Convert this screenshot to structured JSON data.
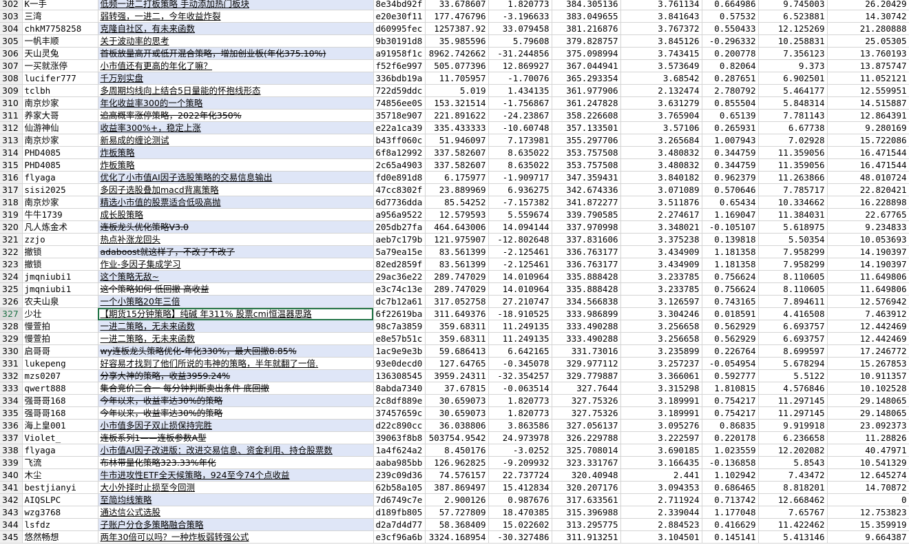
{
  "sheet": {
    "selected_row": "327",
    "rows": [
      {
        "n": "302",
        "user": "K一手",
        "strategy": "低频一进二打板策略 手动添加热门板块",
        "code": "8e34bd92f",
        "v1": "33.678607",
        "v2": "1.820773",
        "v3": "384.305136",
        "v4": "3.761134",
        "v5": "0.664986",
        "v6": "9.745003",
        "v7": "26.20429"
      },
      {
        "n": "303",
        "user": "三湾",
        "strategy": "弱转强，一进二，今年收益炸裂",
        "code": "e20e30f11",
        "v1": "177.476796",
        "v2": "-3.196633",
        "v3": "383.049655",
        "v4": "3.841643",
        "v5": "0.57532",
        "v6": "6.523881",
        "v7": "14.30742"
      },
      {
        "n": "304",
        "user": "chkM7758258",
        "strategy": "克隆自社区，有未来函数",
        "code": "d60995fec",
        "v1": "1257387.92",
        "v2": "33.079458",
        "v3": "381.216876",
        "v4": "3.767372",
        "v5": "0.550433",
        "v6": "12.125269",
        "v7": "21.280888"
      },
      {
        "n": "305",
        "user": "一帆丰顺",
        "strategy": "关于波动率的思考",
        "code": "9b30191d8",
        "v1": "35.985596",
        "v2": "5.79608",
        "v3": "379.828757",
        "v4": "3.845126",
        "v5": "-0.296332",
        "v6": "10.258831",
        "v7": "25.05305"
      },
      {
        "n": "306",
        "user": "天山灵兔",
        "strategy": "首板放量高开或低开混合策略，增加创业板(年化375.10%)",
        "code": "a91958f1c",
        "v1": "8962.742662",
        "v2": "-31.244856",
        "v3": "375.098994",
        "v4": "3.743415",
        "v5": "0.200778",
        "v6": "7.356123",
        "v7": "13.760193"
      },
      {
        "n": "307",
        "user": "一买就涨停",
        "strategy": "小市值还有更高的年化了嘛？",
        "code": "f52f6e997",
        "v1": "505.077396",
        "v2": "12.869927",
        "v3": "367.044941",
        "v4": "3.573649",
        "v5": "0.82064",
        "v6": "9.373",
        "v7": "13.875747"
      },
      {
        "n": "308",
        "user": "lucifer777",
        "strategy": "千万别实盘",
        "code": "336bdb19a",
        "v1": "11.705957",
        "v2": "-1.70076",
        "v3": "365.293354",
        "v4": "3.68542",
        "v5": "0.287651",
        "v6": "6.902501",
        "v7": "11.052121"
      },
      {
        "n": "309",
        "user": "tclbh",
        "strategy": "多周期均线向上结合5日量能的怀抱线形态",
        "code": "722d59ddc",
        "v1": "5.019",
        "v2": "1.434135",
        "v3": "361.977906",
        "v4": "2.132474",
        "v5": "2.780792",
        "v6": "5.464177",
        "v7": "12.559951"
      },
      {
        "n": "310",
        "user": "南京炒家",
        "strategy": "年化收益率300的一个策略",
        "code": "74856ee0S",
        "v1": "153.321514",
        "v2": "-1.756867",
        "v3": "361.247828",
        "v4": "3.631279",
        "v5": "0.855504",
        "v6": "5.848314",
        "v7": "14.515887"
      },
      {
        "n": "311",
        "user": "养家大哥",
        "strategy": "追高概率涨停策略，2022年化350%",
        "code": "35718e907",
        "v1": "221.891622",
        "v2": "-24.23867",
        "v3": "358.226608",
        "v4": "3.765904",
        "v5": "0.65139",
        "v6": "7.781143",
        "v7": "12.864391"
      },
      {
        "n": "312",
        "user": "仙游神仙",
        "strategy": "收益率300%+，稳定上涨",
        "code": "e22a1ca39",
        "v1": "335.433333",
        "v2": "-10.60748",
        "v3": "357.133501",
        "v4": "3.57106",
        "v5": "0.265931",
        "v6": "6.67738",
        "v7": "9.280169"
      },
      {
        "n": "313",
        "user": "南京炒家",
        "strategy": "新易成的缠论测试",
        "code": "b43ff060c",
        "v1": "51.946097",
        "v2": "7.173981",
        "v3": "355.297706",
        "v4": "3.265684",
        "v5": "1.007943",
        "v6": "7.02928",
        "v7": "15.722086"
      },
      {
        "n": "314",
        "user": "PHD4085",
        "strategy": "炸板策略",
        "code": "6f8a12992",
        "v1": "337.582607",
        "v2": "8.635022",
        "v3": "353.757508",
        "v4": "3.480832",
        "v5": "0.344759",
        "v6": "11.359056",
        "v7": "16.471544"
      },
      {
        "n": "315",
        "user": "PHD4085",
        "strategy": "炸板策略",
        "code": "2c65a4903",
        "v1": "337.582607",
        "v2": "8.635022",
        "v3": "353.757508",
        "v4": "3.480832",
        "v5": "0.344759",
        "v6": "11.359056",
        "v7": "16.471544"
      },
      {
        "n": "316",
        "user": "flyaga",
        "strategy": "优化了小市值AI因子选股策略的交易信息输出",
        "code": "fd0e891d8",
        "v1": "6.175977",
        "v2": "-1.909717",
        "v3": "347.359431",
        "v4": "3.840182",
        "v5": "0.962379",
        "v6": "11.263866",
        "v7": "48.010724"
      },
      {
        "n": "317",
        "user": "sisi2025",
        "strategy": "多因子选股叠加macd背离策略",
        "code": "47cc8302f",
        "v1": "23.889969",
        "v2": "6.936275",
        "v3": "342.674336",
        "v4": "3.071089",
        "v5": "0.570646",
        "v6": "7.785717",
        "v7": "22.820421"
      },
      {
        "n": "318",
        "user": "南京炒家",
        "strategy": "精选小市值的股票适合低吸高抛",
        "code": "6d7736dda",
        "v1": "85.54252",
        "v2": "-7.157382",
        "v3": "341.872277",
        "v4": "3.511876",
        "v5": "0.65434",
        "v6": "10.334662",
        "v7": "16.228898"
      },
      {
        "n": "319",
        "user": "牛牛1739",
        "strategy": "成长股策略",
        "code": "a956a9522",
        "v1": "12.579593",
        "v2": "5.559674",
        "v3": "339.790585",
        "v4": "2.274617",
        "v5": "1.169047",
        "v6": "11.384031",
        "v7": "22.67765"
      },
      {
        "n": "320",
        "user": "凡人炼金术",
        "strategy": "连板龙头优化策略V3.0",
        "code": "205db27fa",
        "v1": "464.643006",
        "v2": "14.094144",
        "v3": "337.970998",
        "v4": "3.348021",
        "v5": "-0.105107",
        "v6": "5.618975",
        "v7": "9.234833"
      },
      {
        "n": "321",
        "user": "zzjo",
        "strategy": "热点补涨龙回头",
        "code": "aeb7c179b",
        "v1": "121.975907",
        "v2": "-12.802648",
        "v3": "337.831606",
        "v4": "3.375238",
        "v5": "0.139818",
        "v6": "5.50354",
        "v7": "10.053693"
      },
      {
        "n": "322",
        "user": "撤锁",
        "strategy": "adaboost就这样了，不改了不改了",
        "code": "5a79ea15e",
        "v1": "83.561399",
        "v2": "-2.125461",
        "v3": "336.763177",
        "v4": "3.434909",
        "v5": "1.181358",
        "v6": "7.958299",
        "v7": "14.190397"
      },
      {
        "n": "323",
        "user": "撤锁",
        "strategy": "作业-多因子集成学习",
        "code": "82ed2859f",
        "v1": "83.561399",
        "v2": "-2.125461",
        "v3": "336.763177",
        "v4": "3.434909",
        "v5": "1.181358",
        "v6": "7.958299",
        "v7": "14.190397"
      },
      {
        "n": "324",
        "user": "jmqniubi1",
        "strategy": "这个策略无敌~",
        "code": "29ac36e22",
        "v1": "289.747029",
        "v2": "14.010964",
        "v3": "335.888428",
        "v4": "3.233785",
        "v5": "0.756624",
        "v6": "8.110605",
        "v7": "11.649806"
      },
      {
        "n": "325",
        "user": "jmqniubi1",
        "strategy": "这个策略如何 低回撤 高收益",
        "code": "e3c74c13e",
        "v1": "289.747029",
        "v2": "14.010964",
        "v3": "335.888428",
        "v4": "3.233785",
        "v5": "0.756624",
        "v6": "8.110605",
        "v7": "11.649806"
      },
      {
        "n": "326",
        "user": "农夫山泉",
        "strategy": "一个小策略20年三倍",
        "code": "dc7b12a61",
        "v1": "317.052758",
        "v2": "27.210747",
        "v3": "334.566838",
        "v4": "3.126597",
        "v5": "0.743165",
        "v6": "7.894611",
        "v7": "12.576942"
      },
      {
        "n": "327",
        "user": "少壮",
        "strategy": "【期货15分钟策略】纯碱 年311% 股票cmi恒温器思路",
        "code": "6f22619ba",
        "v1": "311.649376",
        "v2": "-18.910525",
        "v3": "333.986899",
        "v4": "3.304246",
        "v5": "0.018591",
        "v6": "4.416508",
        "v7": "7.463912"
      },
      {
        "n": "328",
        "user": "慢萱拍",
        "strategy": "一进二策略，无未来函数",
        "code": "98c7a3859",
        "v1": "359.68311",
        "v2": "11.249135",
        "v3": "333.490288",
        "v4": "3.256658",
        "v5": "0.562929",
        "v6": "6.693757",
        "v7": "12.442469"
      },
      {
        "n": "329",
        "user": "慢萱拍",
        "strategy": "一进二策略，无未来函数",
        "code": "e8e57b51c",
        "v1": "359.68311",
        "v2": "11.249135",
        "v3": "333.490288",
        "v4": "3.256658",
        "v5": "0.562929",
        "v6": "6.693757",
        "v7": "12.442469"
      },
      {
        "n": "330",
        "user": "启哥哥",
        "strategy": "wy连板龙头策略优化-年化330%，最大回撤8.85%",
        "code": "1ac9e9e3b",
        "v1": "59.686413",
        "v2": "6.642165",
        "v3": "331.73016",
        "v4": "3.235899",
        "v5": "0.226764",
        "v6": "8.699597",
        "v7": "17.246772"
      },
      {
        "n": "331",
        "user": "lukepeng",
        "strategy": "好容易才找到了他们所说的韦神的策略，半年就翻了一倍.",
        "code": "93e0decd0",
        "v1": "127.64765",
        "v2": "-0.345078",
        "v3": "329.977112",
        "v4": "3.257237",
        "v5": "-0.054954",
        "v6": "5.678294",
        "v7": "15.267853"
      },
      {
        "n": "332",
        "user": "mzs0207",
        "strategy": "分享大神的策略，收益3959.24%",
        "code": "136308545",
        "v1": "3959.24311",
        "v2": "-32.354257",
        "v3": "329.779887",
        "v4": "3.366061",
        "v5": "0.592777",
        "v6": "5.5122",
        "v7": "10.911357"
      },
      {
        "n": "333",
        "user": "qwert888",
        "strategy": "集合竞价三合一 每分钟判断卖出条件 底回撤",
        "code": "8abda7340",
        "v1": "37.67815",
        "v2": "-0.063514",
        "v3": "327.7644",
        "v4": "3.315298",
        "v5": "1.810815",
        "v6": "4.576846",
        "v7": "10.102528"
      },
      {
        "n": "334",
        "user": "强哥哥168",
        "strategy": "今年以来，收益率达30%的策略",
        "code": "2c8df889e",
        "v1": "30.659073",
        "v2": "1.820773",
        "v3": "327.75326",
        "v4": "3.189991",
        "v5": "0.754217",
        "v6": "11.297145",
        "v7": "29.148065"
      },
      {
        "n": "335",
        "user": "强哥哥168",
        "strategy": "今年以来，收益率达30%的策略",
        "code": "37457659c",
        "v1": "30.659073",
        "v2": "1.820773",
        "v3": "327.75326",
        "v4": "3.189991",
        "v5": "0.754217",
        "v6": "11.297145",
        "v7": "29.148065"
      },
      {
        "n": "336",
        "user": "海上皇001",
        "strategy": "小市值多因子双止损保持完胜",
        "code": "d22c890cc",
        "v1": "36.038806",
        "v2": "3.863586",
        "v3": "327.056137",
        "v4": "3.095276",
        "v5": "0.86835",
        "v6": "9.919918",
        "v7": "23.092373"
      },
      {
        "n": "337",
        "user": "Violet_",
        "strategy": "连板系列1——连板参数A型",
        "code": "39063f8b8",
        "v1": "503754.9542",
        "v2": "24.973978",
        "v3": "326.229788",
        "v4": "3.222597",
        "v5": "0.220178",
        "v6": "6.236658",
        "v7": "11.28826"
      },
      {
        "n": "338",
        "user": "flyaga",
        "strategy": "小市值AI因子改进版：改进交易信息、资金利用、持仓股票数",
        "code": "1a4f624a2",
        "v1": "8.450176",
        "v2": "-3.0252",
        "v3": "325.708014",
        "v4": "3.690185",
        "v5": "1.023559",
        "v6": "12.202082",
        "v7": "40.47971"
      },
      {
        "n": "339",
        "user": "飞流",
        "strategy": "布林带量化策略323.33%年化",
        "code": "aaba985bb",
        "v1": "126.962825",
        "v2": "-9.209932",
        "v3": "323.331767",
        "v4": "3.166435",
        "v5": "-0.136858",
        "v6": "5.8543",
        "v7": "10.541329"
      },
      {
        "n": "340",
        "user": "木尘",
        "strategy": "牛市进攻性ETF全天候策略，924至今74个点收益",
        "code": "239c09d36",
        "v1": "74.576157",
        "v2": "22.737724",
        "v3": "320.40948",
        "v4": "2.441",
        "v5": "1.102942",
        "v6": "7.43472",
        "v7": "12.645274"
      },
      {
        "n": "341",
        "user": "bestjianyi",
        "strategy": "大小外择时止损至今回测",
        "code": "62b58a105",
        "v1": "387.869497",
        "v2": "15.412834",
        "v3": "320.207176",
        "v4": "3.094353",
        "v5": "0.686465",
        "v6": "8.818201",
        "v7": "14.70872"
      },
      {
        "n": "342",
        "user": "AIQSLPC",
        "strategy": "至简均线策略",
        "code": "7d6749c7e",
        "v1": "2.900126",
        "v2": "0.987676",
        "v3": "317.633561",
        "v4": "2.711924",
        "v5": "0.713742",
        "v6": "12.668462",
        "v7": "0"
      },
      {
        "n": "343",
        "user": "wzg3768",
        "strategy": "通达信公式选股",
        "code": "d189fb805",
        "v1": "57.727809",
        "v2": "18.470385",
        "v3": "315.396988",
        "v4": "2.339044",
        "v5": "1.177048",
        "v6": "7.65767",
        "v7": "12.753823"
      },
      {
        "n": "344",
        "user": "lsfdz",
        "strategy": "子账户分仓多策略融合策略",
        "code": "d2a7d4d77",
        "v1": "58.368409",
        "v2": "15.022602",
        "v3": "313.295775",
        "v4": "2.884523",
        "v5": "0.416629",
        "v6": "11.422462",
        "v7": "15.359919"
      },
      {
        "n": "345",
        "user": "悠然畅想",
        "strategy": "两年30倍可以吗？一种炸板弱转强公式",
        "code": "e3cf96a6b",
        "v1": "3324.168954",
        "v2": "-30.327486",
        "v3": "311.913251",
        "v4": "3.104501",
        "v5": "0.145141",
        "v6": "5.413146",
        "v7": "9.664387"
      }
    ]
  }
}
